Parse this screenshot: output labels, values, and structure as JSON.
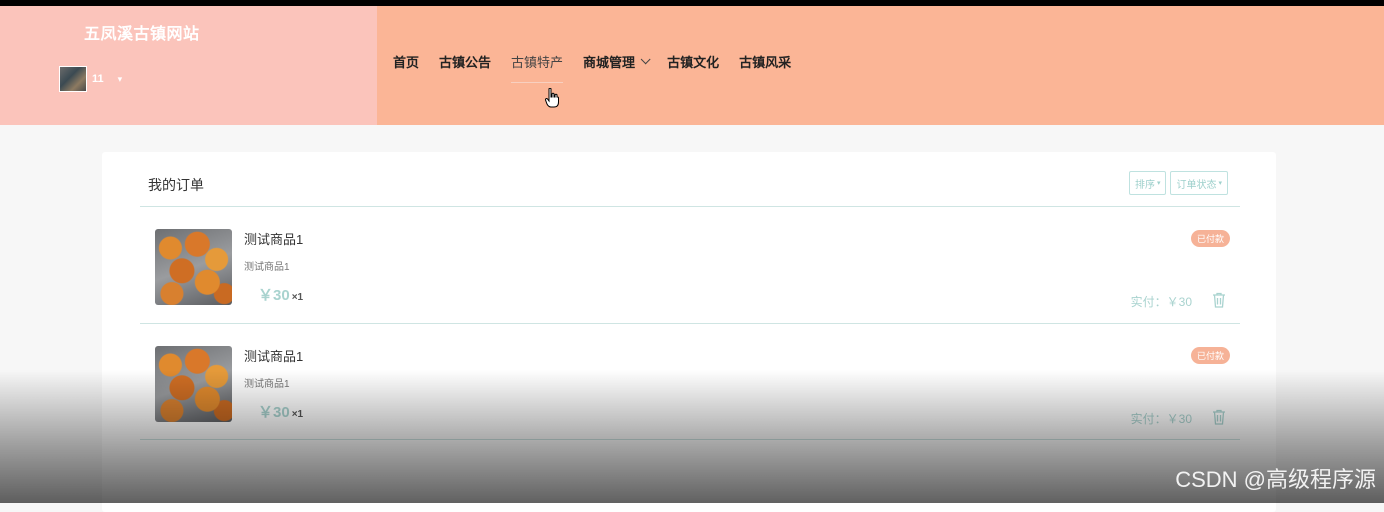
{
  "header": {
    "site_title": "五凤溪古镇网站",
    "user": {
      "name": "11",
      "caret": "▾"
    },
    "nav": [
      {
        "label": "首页"
      },
      {
        "label": "古镇公告"
      },
      {
        "label": "古镇特产",
        "active": true
      },
      {
        "label": "商城管理",
        "dropdown": true
      },
      {
        "label": "古镇文化"
      },
      {
        "label": "古镇风采"
      }
    ]
  },
  "orders_panel": {
    "title": "我的订单",
    "filters": [
      {
        "label": "排序",
        "caret": "▾"
      },
      {
        "label": "订单状态",
        "caret": "▾"
      }
    ],
    "orders": [
      {
        "name": "测试商品1",
        "desc": "测试商品1",
        "price": "￥30",
        "qty": "×1",
        "status": "已付款",
        "paid": "实付：￥30"
      },
      {
        "name": "测试商品1",
        "desc": "测试商品1",
        "price": "￥30",
        "qty": "×1",
        "status": "已付款",
        "paid": "实付：￥30"
      }
    ]
  },
  "watermark": "CSDN @高级程序源",
  "colors": {
    "header_bg": "#fbb596",
    "brand_bg": "#fbc4bb",
    "accent_teal": "#a9d3cf",
    "status_bg": "#f6b297"
  }
}
